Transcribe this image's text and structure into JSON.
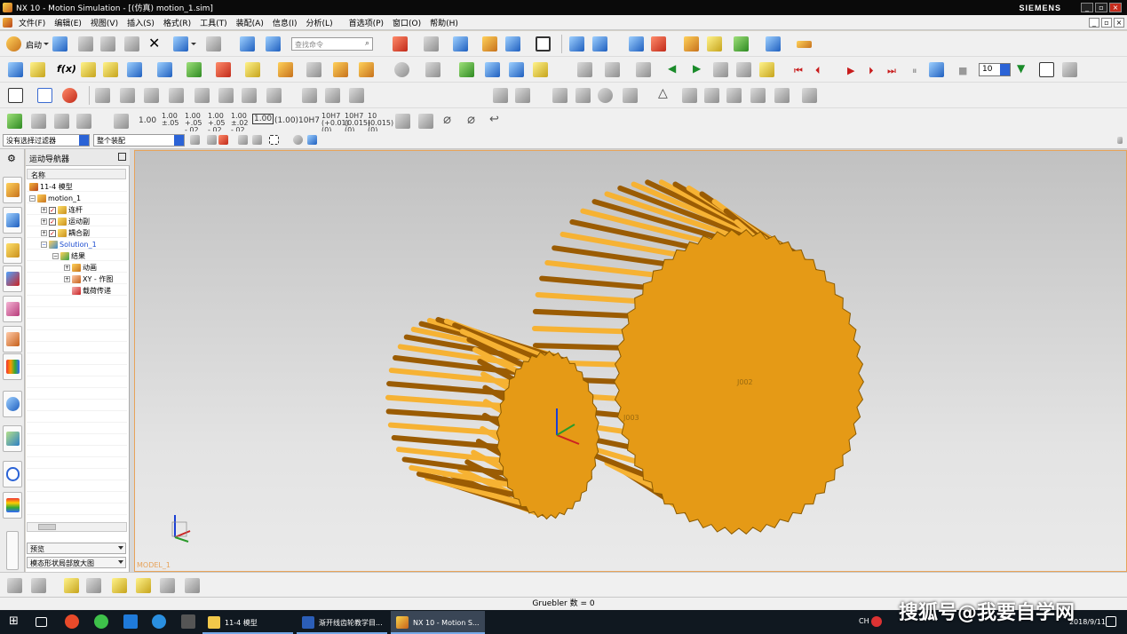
{
  "window": {
    "title": "NX 10 - Motion Simulation - [(仿真) motion_1.sim]",
    "brand": "SIEMENS"
  },
  "menu": [
    "文件(F)",
    "编辑(E)",
    "视图(V)",
    "插入(S)",
    "格式(R)",
    "工具(T)",
    "装配(A)",
    "信息(I)",
    "分析(L)",
    "首选项(P)",
    "窗口(O)",
    "帮助(H)"
  ],
  "toolbar1": {
    "start_label": "启动",
    "search_placeholder": "查找命令"
  },
  "tolerance": {
    "t100": "1.00",
    "t_pm05": [
      "1.00",
      "±.05"
    ],
    "t_pm05b": [
      "1.00",
      "+.05",
      "-.02"
    ],
    "t_pm05c": [
      "1.00",
      "+.05",
      "-.02"
    ],
    "t_pm05d": [
      "1.00",
      "±.02",
      "-.02"
    ],
    "boxed": "1.00",
    "paren": "(1.00)",
    "fit": "10H7",
    "fit2": [
      "10H7",
      "(+0.01)",
      "(0)"
    ],
    "fit3": [
      "10H7",
      "(0.015)",
      "(0)"
    ],
    "fit4": [
      "10",
      "(0.015)",
      "(0)"
    ]
  },
  "playback": {
    "frames": "10"
  },
  "filters": {
    "selection_filter": "没有选择过滤器",
    "scope": "整个装配"
  },
  "navigator": {
    "title": "运动导航器",
    "column": "名称",
    "nodes": [
      {
        "label": "11-4 模型"
      },
      {
        "label": "motion_1"
      },
      {
        "label": "连杆"
      },
      {
        "label": "运动副"
      },
      {
        "label": "耦合副"
      },
      {
        "label": "Solution_1"
      },
      {
        "label": "结果"
      },
      {
        "label": "动画"
      },
      {
        "label": "XY - 作图"
      },
      {
        "label": "载荷传递"
      }
    ],
    "preview": "预览",
    "bottom": "模态形状局部放大图"
  },
  "viewport": {
    "model_label": "MODEL_1",
    "labels": [
      "J002",
      "J003"
    ],
    "gear_color": "#e59a16",
    "edge_color": "#8a5a00"
  },
  "status": {
    "text": "Gruebler 数 = 0"
  },
  "taskbar": {
    "apps": [
      {
        "label": "11-4 模型"
      },
      {
        "label": "渐开线齿轮教学目..."
      },
      {
        "label": "NX 10 - Motion S..."
      }
    ],
    "time": "",
    "date": "2018/9/11",
    "ime": "CH"
  },
  "watermark": "搜狐号@我要自学网"
}
